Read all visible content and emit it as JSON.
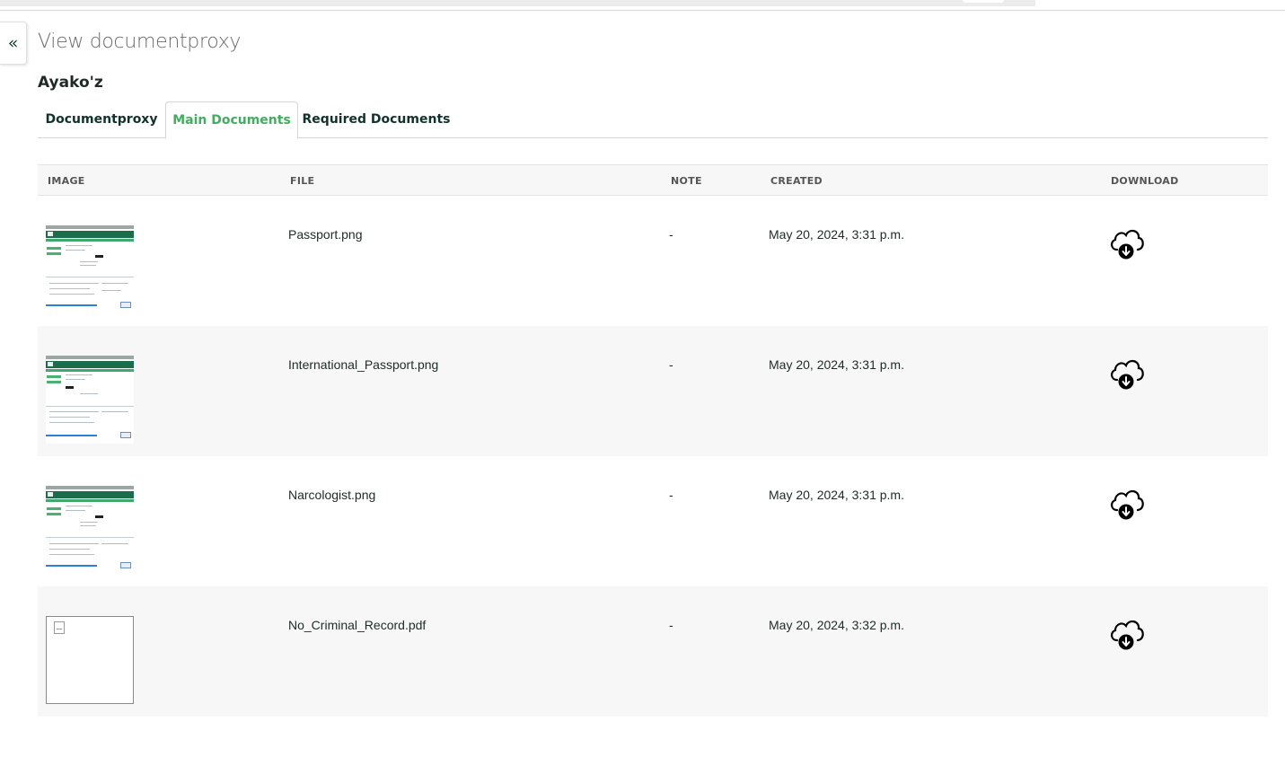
{
  "page": {
    "title": "View documentproxy",
    "collapse_label": "«",
    "record_name": "Ayako'z"
  },
  "tabs": [
    {
      "label": "Documentproxy",
      "active": false
    },
    {
      "label": "Main Documents",
      "active": true
    },
    {
      "label": "Required Documents",
      "active": false
    }
  ],
  "colors": {
    "active_tab": "#3fae5e",
    "text_dark": "#10322a",
    "row_alt_bg": "#f7f7f7"
  },
  "table": {
    "headers": {
      "image": "IMAGE",
      "file": "FILE",
      "note": "NOTE",
      "created": "CREATED",
      "download": "DOWNLOAD"
    },
    "rows": [
      {
        "image": "screenshot-thumbnail",
        "file": "Passport.png",
        "note": "-",
        "created": "May 20, 2024, 3:31 p.m.",
        "download_icon": "cloud-download-icon"
      },
      {
        "image": "screenshot-thumbnail",
        "file": "International_Passport.png",
        "note": "-",
        "created": "May 20, 2024, 3:31 p.m.",
        "download_icon": "cloud-download-icon"
      },
      {
        "image": "screenshot-thumbnail",
        "file": "Narcologist.png",
        "note": "-",
        "created": "May 20, 2024, 3:31 p.m.",
        "download_icon": "cloud-download-icon"
      },
      {
        "image": "broken-image-icon",
        "file": "No_Criminal_Record.pdf",
        "note": "-",
        "created": "May 20, 2024, 3:32 p.m.",
        "download_icon": "cloud-download-icon"
      }
    ]
  }
}
